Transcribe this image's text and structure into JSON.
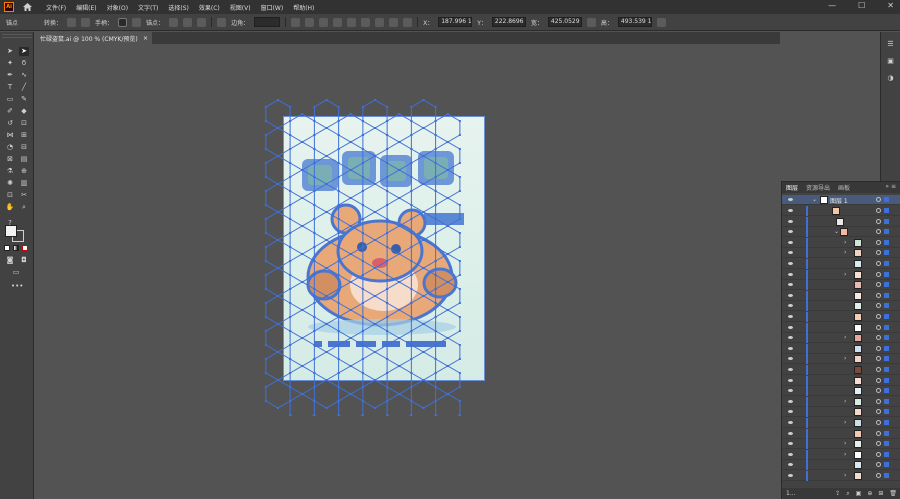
{
  "menubar": {
    "logo": "Ai",
    "items": [
      "文件(F)",
      "编辑(E)",
      "对象(O)",
      "文字(T)",
      "选择(S)",
      "效果(C)",
      "视图(V)",
      "窗口(W)",
      "帮助(H)"
    ],
    "window_buttons": [
      "—",
      "☐",
      "✕"
    ]
  },
  "controlbar": {
    "anchor_label": "锚点",
    "convert_label": "转换：",
    "handle_label": "手柄：",
    "anchors_label": "锚点：",
    "corner_label": "边角：",
    "x_label": "X：",
    "x_value": "187.996 1",
    "y_label": "Y：",
    "y_value": "222.8696",
    "w_label": "宽：",
    "w_value": "425.0529",
    "h_label": "高：",
    "h_value": "493.539 1"
  },
  "document": {
    "tab_title": "忙碌盗鼠.ai @ 100 % (CMYK/预览)",
    "tab_close": "×"
  },
  "layers_panel": {
    "tabs": [
      "图层",
      "资源导出",
      "画板"
    ],
    "active_tab": "图层",
    "top_layer_name": "图层 1",
    "footer_count": "1..."
  },
  "colors": {
    "accent": "#3f70d8",
    "canvas": "#535353",
    "panel": "#424242",
    "menubar": "#323232"
  }
}
